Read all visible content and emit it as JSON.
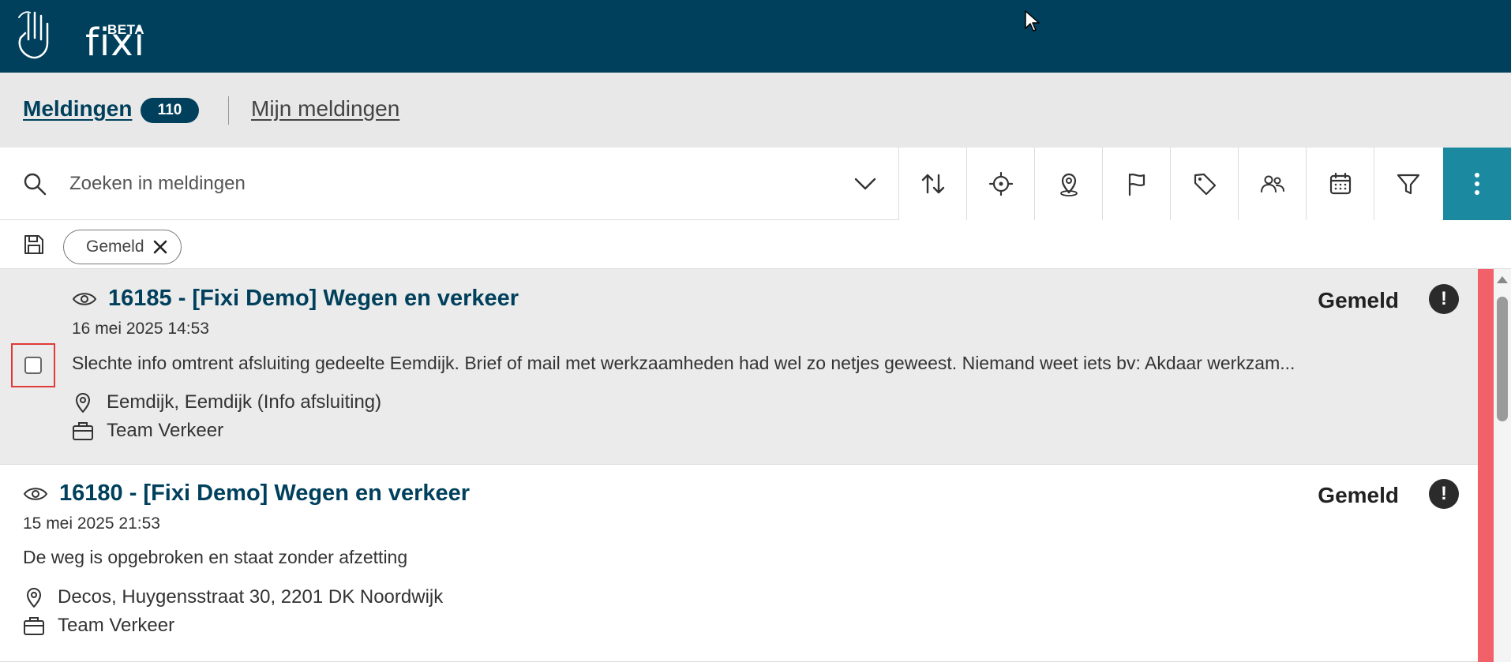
{
  "header": {
    "logo_text": "fixi",
    "logo_badge": "BETA"
  },
  "tabs": {
    "main_label": "Meldingen",
    "main_count": "110",
    "mine_label": "Mijn meldingen"
  },
  "search": {
    "placeholder": "Zoeken in meldingen"
  },
  "toolbar": {
    "buttons": [
      "sort-icon",
      "crosshair-icon",
      "map-pin-icon",
      "flag-icon",
      "tag-icon",
      "people-icon",
      "calendar-icon",
      "filter-icon"
    ],
    "more": "more-vertical-icon"
  },
  "filters": {
    "chip_label": "Gemeld"
  },
  "items": [
    {
      "title": "16185 - [Fixi Demo] Wegen en verkeer",
      "date": "16 mei 2025 14:53",
      "description": "Slechte info omtrent afsluiting gedeelte Eemdijk. Brief of mail met werkzaamheden had wel zo netjes geweest. Niemand weet iets bv: Akdaar werkzam...",
      "location": "Eemdijk, Eemdijk (Info afsluiting)",
      "team": "Team Verkeer",
      "status": "Gemeld",
      "alert": "!"
    },
    {
      "title": "16180 - [Fixi Demo] Wegen en verkeer",
      "date": "15 mei 2025 21:53",
      "description": "De weg is opgebroken en staat zonder afzetting",
      "location": "Decos, Huygensstraat 30, 2201 DK Noordwijk",
      "team": "Team Verkeer",
      "status": "Gemeld",
      "alert": "!"
    }
  ],
  "colors": {
    "header_bg": "#00405c",
    "accent": "#1b8aa0",
    "priority": "#f2606a"
  }
}
